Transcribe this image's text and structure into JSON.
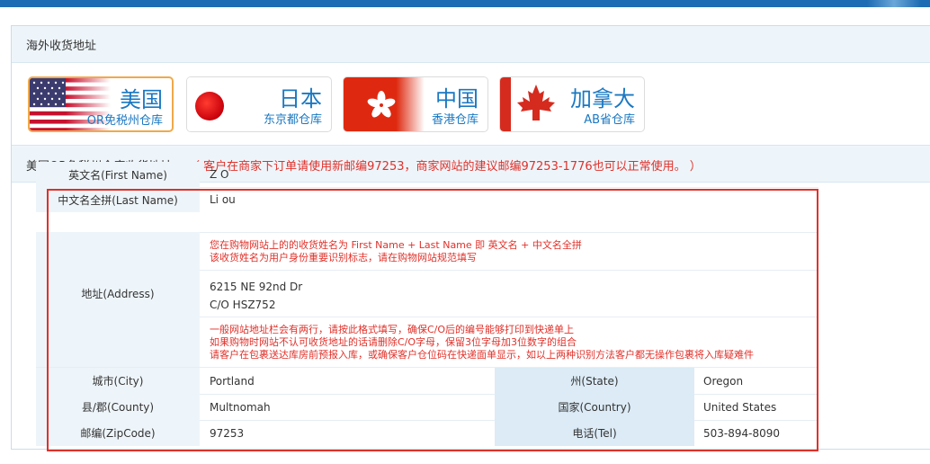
{
  "panel": {
    "title": "海外收货地址"
  },
  "tabs": [
    {
      "main": "美国",
      "sub": "OR免税州仓库",
      "active": true
    },
    {
      "main": "日本",
      "sub": "东京都仓库",
      "active": false
    },
    {
      "main": "中国",
      "sub": "香港仓库",
      "active": false
    },
    {
      "main": "加拿大",
      "sub": "AB省仓库",
      "active": false
    }
  ],
  "notice": {
    "label": "美国OR免税州仓库收货地址",
    "hint": "（ 客户在商家下订单请使用新邮编97253，商家网站的建议邮编97253-1776也可以正常使用。 ）"
  },
  "address": {
    "first_name_label": "英文名(First Name)",
    "first_name_value": "Z  O",
    "last_name_label": "中文名全拼(Last Name)",
    "last_name_value": "Li         ou",
    "name_note_1": "您在购物网站上的的收货姓名为 First Name + Last Name 即 英文名 + 中文名全拼",
    "name_note_2": "该收货姓名为用户身份重要识别标志，请在购物网站规范填写",
    "address_label": "地址(Address)",
    "address_line1": "6215 NE 92nd Dr",
    "address_line2": "C/O HSZ752",
    "address_note_1": "一般网站地址栏会有两行，请按此格式填写，确保C/O后的编号能够打印到快递单上",
    "address_note_2": "如果购物时网站不认可收货地址的话请删除C/O字母，保留3位字母加3位数字的组合",
    "address_note_3": "请客户在包裹送达库房前预报入库，或确保客户仓位码在快递面单显示，如以上两种识别方法客户都无操作包裹将入库疑难件",
    "city_label": "城市(City)",
    "city_value": "Portland",
    "state_label": "州(State)",
    "state_value": "Oregon",
    "county_label": "县/郡(County)",
    "county_value": "Multnomah",
    "country_label": "国家(Country)",
    "country_value": "United States",
    "zip_label": "邮编(ZipCode)",
    "zip_value": "97253",
    "tel_label": "电话(Tel)",
    "tel_value": "503-894-8090"
  },
  "colors": {
    "accent": "#1a78c2",
    "warning": "#e0312a",
    "active_border": "#f0a94a",
    "highlight_box": "#e0312a"
  }
}
